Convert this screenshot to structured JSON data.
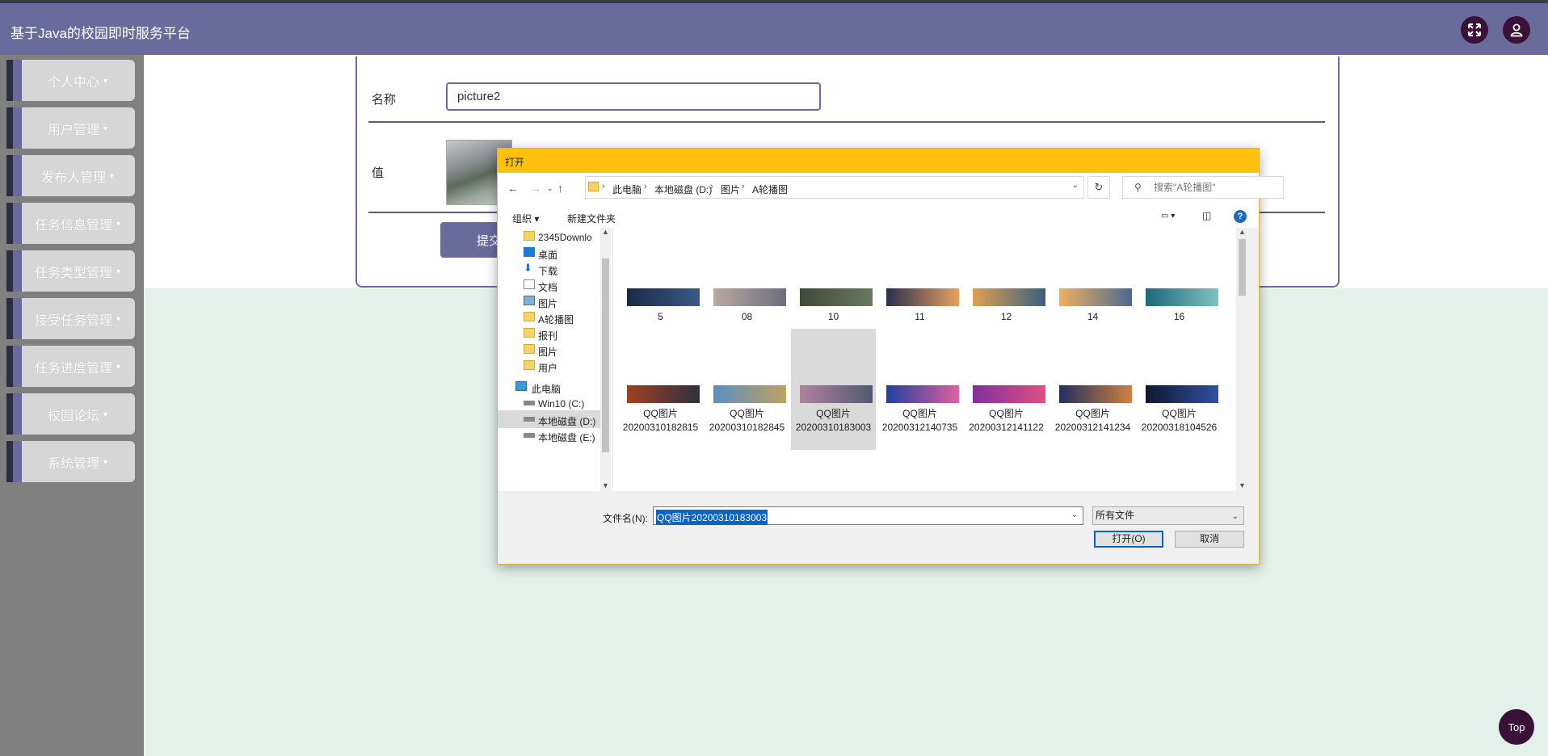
{
  "app": {
    "title": "基于Java的校园即时服务平台",
    "top_label": "Top"
  },
  "sidebar": {
    "items": [
      {
        "label": "个人中心"
      },
      {
        "label": "用户管理"
      },
      {
        "label": "发布人管理"
      },
      {
        "label": "任务信息管理"
      },
      {
        "label": "任务类型管理"
      },
      {
        "label": "接受任务管理"
      },
      {
        "label": "任务进度管理"
      },
      {
        "label": "校园论坛"
      },
      {
        "label": "系统管理"
      }
    ]
  },
  "form": {
    "name_label": "名称",
    "name_value": "picture2",
    "value_label": "值",
    "submit_label": "提交"
  },
  "dialog": {
    "title": "打开",
    "breadcrumb": [
      "此电脑",
      "本地磁盘 (D:)",
      "图片",
      "A轮播图"
    ],
    "search_placeholder": "搜索\"A轮播图\"",
    "toolbar": {
      "organize": "组织",
      "new_folder": "新建文件夹"
    },
    "nav_items": [
      {
        "label": "2345Downlo",
        "type": "folder",
        "pinned": true
      },
      {
        "label": "桌面",
        "type": "desktop",
        "pinned": true
      },
      {
        "label": "下载",
        "type": "download",
        "pinned": true
      },
      {
        "label": "文档",
        "type": "document",
        "pinned": true
      },
      {
        "label": "图片",
        "type": "pictures",
        "pinned": true
      },
      {
        "label": "A轮播图",
        "type": "folder"
      },
      {
        "label": "报刊",
        "type": "folder"
      },
      {
        "label": "图片",
        "type": "folder"
      },
      {
        "label": "用户",
        "type": "folder"
      },
      {
        "label": "此电脑",
        "type": "computer"
      },
      {
        "label": "Win10 (C:)",
        "type": "drive"
      },
      {
        "label": "本地磁盘 (D:)",
        "type": "drive",
        "selected": true
      },
      {
        "label": "本地磁盘 (E:)",
        "type": "drive"
      }
    ],
    "files_row1": [
      {
        "name": "5",
        "colors": [
          "#1b2a44",
          "#3b5a8a"
        ]
      },
      {
        "name": "08",
        "colors": [
          "#b9a8a0",
          "#6e6e80"
        ]
      },
      {
        "name": "10",
        "colors": [
          "#3e4a3a",
          "#6a7a60"
        ]
      },
      {
        "name": "11",
        "colors": [
          "#2a3050",
          "#e8a060"
        ]
      },
      {
        "name": "12",
        "colors": [
          "#e0a050",
          "#3a6080"
        ]
      },
      {
        "name": "14",
        "colors": [
          "#f0b060",
          "#4a6a90"
        ]
      },
      {
        "name": "16",
        "colors": [
          "#1a6a7a",
          "#80c0c0"
        ]
      }
    ],
    "files_row2": [
      {
        "name": "QQ图片20200310182815",
        "colors": [
          "#a04020",
          "#303040"
        ]
      },
      {
        "name": "QQ图片20200310182845",
        "colors": [
          "#5a90c0",
          "#c0a060"
        ]
      },
      {
        "name": "QQ图片20200310183003",
        "colors": [
          "#b080a0",
          "#505a70"
        ],
        "selected": true
      },
      {
        "name": "QQ图片20200312140735",
        "colors": [
          "#2040a0",
          "#e060a0"
        ]
      },
      {
        "name": "QQ图片20200312141122",
        "colors": [
          "#8030a0",
          "#e05080"
        ]
      },
      {
        "name": "QQ图片20200312141234",
        "colors": [
          "#203060",
          "#d08040"
        ]
      },
      {
        "name": "QQ图片20200318104526",
        "colors": [
          "#101830",
          "#3050a0"
        ]
      }
    ],
    "filename_label": "文件名(N):",
    "filename_value": "QQ图片20200310183003",
    "filetype_value": "所有文件",
    "open_label": "打开(O)",
    "cancel_label": "取消"
  }
}
